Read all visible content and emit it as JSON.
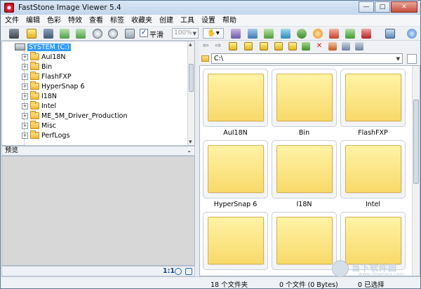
{
  "window": {
    "title": "FastStone Image Viewer 5.4",
    "controls": [
      "—",
      "□",
      "✕"
    ]
  },
  "menu": [
    "文件",
    "编辑",
    "色彩",
    "特效",
    "查看",
    "标签",
    "收藏夹",
    "创建",
    "工具",
    "设置",
    "帮助"
  ],
  "toolbar": {
    "smooth_label": "平滑",
    "smooth_checked": "✓",
    "zoom_value": "100%",
    "zoom_arrow": "▼",
    "hand_label": "✋▾"
  },
  "tree": {
    "root": "SYSTEM (C:)",
    "items": [
      "AuI18N",
      "Bin",
      "FlashFXP",
      "HyperSnap 6",
      "I18N",
      "Intel",
      "ME_5M_Driver_Production",
      "Misc",
      "PerfLogs"
    ],
    "expander": "+",
    "scroll_up": "▲",
    "scroll_down": "▼"
  },
  "preview": {
    "title": "预览",
    "collapse": "⌄",
    "ratio_label": "1:1"
  },
  "path": {
    "value": "C:\\",
    "arrow": "▼",
    "nav_back": "⇦",
    "nav_forward": "⇨",
    "close_mark": "✕"
  },
  "thumbnails": [
    {
      "label": "AuI18N"
    },
    {
      "label": "Bin"
    },
    {
      "label": "FlashFXP"
    },
    {
      "label": "HyperSnap 6"
    },
    {
      "label": "I18N"
    },
    {
      "label": "Intel"
    },
    {
      "label": ""
    },
    {
      "label": ""
    },
    {
      "label": ""
    }
  ],
  "status": {
    "folders": "18 个文件夹",
    "files": "0 个文件 (0 Bytes)",
    "selected": "0 已选择"
  },
  "watermark": {
    "text": "当下软件园",
    "sub": "www.downxia.com"
  },
  "colors": {
    "selection": "#3399ff",
    "folder_thumb": "#f8d96a",
    "titlebar": "#c3d6ec"
  }
}
